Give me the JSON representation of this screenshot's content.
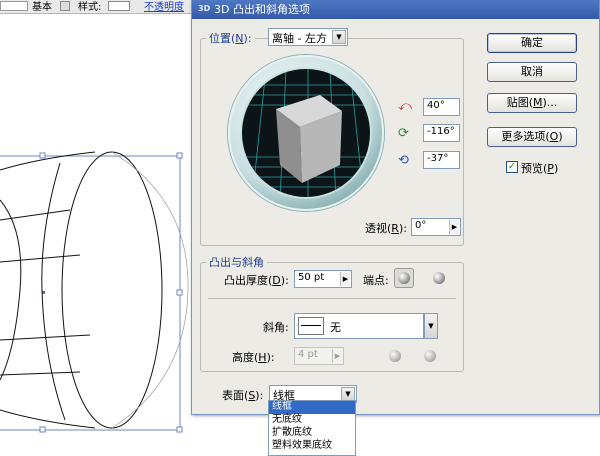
{
  "toolbar": {
    "basic_label": "基本",
    "style_label": "样式:",
    "opacity_label": "不透明度"
  },
  "dialog": {
    "title": "3D 凸出和斜角选项",
    "title_icon": "3D",
    "position": {
      "label": "位置(N):",
      "label_text": "位置(",
      "label_key": "N",
      "label_end": "):",
      "value": "离轴 - 左方"
    },
    "rotation": {
      "x_value": "40°",
      "y_value": "-116°",
      "z_value": "-37°"
    },
    "perspective": {
      "label_text": "透视(",
      "label_key": "R",
      "label_end": "):",
      "value": "0°"
    },
    "extrude": {
      "group_label": "凸出与斜角",
      "depth_label_text": "凸出厚度(",
      "depth_label_key": "D",
      "depth_label_end": "):",
      "depth_value": "50 pt",
      "cap_label": "端点:"
    },
    "bevel": {
      "label": "斜角:",
      "value": "无",
      "height_label_text": "高度(",
      "height_label_key": "H",
      "height_label_end": "):",
      "height_value": "4 pt"
    },
    "surface": {
      "label_text": "表面(",
      "label_key": "S",
      "label_end": "):",
      "value": "线框",
      "options": [
        "线框",
        "无底纹",
        "扩散底纹",
        "塑料效果底纹"
      ],
      "selected_index": 0
    },
    "buttons": {
      "ok": "确定",
      "cancel": "取消",
      "map": "贴图(M)...",
      "map_text": "贴图(",
      "map_key": "M",
      "map_end": ")...",
      "more_text": "更多选项(",
      "more_key": "O",
      "more_end": ")"
    },
    "preview": {
      "label_text": "预览(",
      "label_key": "P",
      "label_end": ")",
      "checked": true
    }
  },
  "colors": {
    "title_bar": "#3d64b4",
    "group_label": "#1f3e8f",
    "selection": "#3169c6",
    "trackball_ring": "#6f9da0",
    "trackball_grid": "#3ec4c9"
  }
}
